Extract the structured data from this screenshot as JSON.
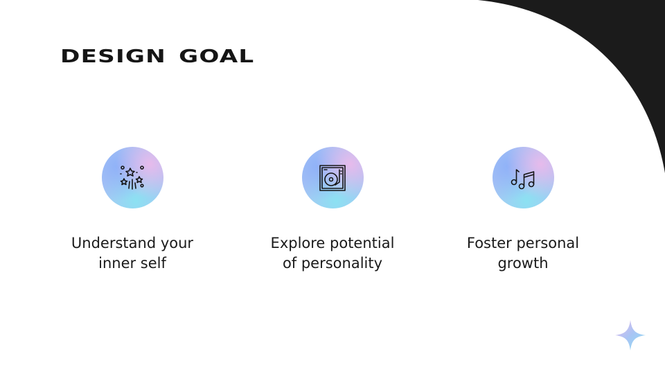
{
  "slide": {
    "title": "Design Goal",
    "colors": {
      "dark_shape": "#1b1b1b",
      "text": "#1a1a1a",
      "gradient_blue": "#8eb1f8",
      "gradient_pink": "#eabaeb",
      "gradient_cyan": "#8ce1f2"
    },
    "goals": [
      {
        "icon": "fireworks-icon",
        "text": "Understand your\ninner self"
      },
      {
        "icon": "turntable-icon",
        "text": "Explore potential\nof personality"
      },
      {
        "icon": "music-notes-icon",
        "text": "Foster personal\ngrowth"
      }
    ],
    "decoration": "sparkle-star-icon"
  }
}
